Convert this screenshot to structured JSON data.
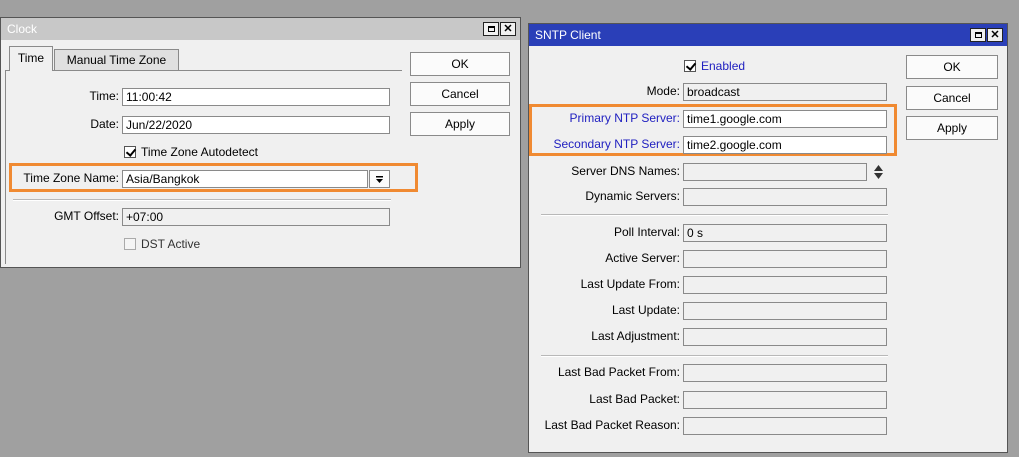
{
  "clock": {
    "title": "Clock",
    "tabs": [
      "Time",
      "Manual Time Zone"
    ],
    "time_label": "Time:",
    "time_value": "11:00:42",
    "date_label": "Date:",
    "date_value": "Jun/22/2020",
    "autodetect_label": "Time Zone Autodetect",
    "autodetect_checked": true,
    "tz_label": "Time Zone Name:",
    "tz_value": "Asia/Bangkok",
    "gmt_label": "GMT Offset:",
    "gmt_value": "+07:00",
    "dst_label": "DST Active",
    "dst_checked": false,
    "buttons": {
      "ok": "OK",
      "cancel": "Cancel",
      "apply": "Apply"
    }
  },
  "sntp": {
    "title": "SNTP Client",
    "enabled_label": "Enabled",
    "enabled_checked": true,
    "mode_label": "Mode:",
    "mode_value": "broadcast",
    "primary_label": "Primary NTP Server:",
    "primary_value": "time1.google.com",
    "secondary_label": "Secondary NTP Server:",
    "secondary_value": "time2.google.com",
    "dns_label": "Server DNS Names:",
    "dns_value": "",
    "dynamic_label": "Dynamic Servers:",
    "dynamic_value": "",
    "poll_label": "Poll Interval:",
    "poll_value": "0 s",
    "active_label": "Active Server:",
    "active_value": "",
    "last_update_from_label": "Last Update From:",
    "last_update_from_value": "",
    "last_update_label": "Last Update:",
    "last_update_value": "",
    "last_adjustment_label": "Last Adjustment:",
    "last_adjustment_value": "",
    "bad_from_label": "Last Bad Packet From:",
    "bad_from_value": "",
    "bad_label": "Last Bad Packet:",
    "bad_value": "",
    "bad_reason_label": "Last Bad Packet Reason:",
    "bad_reason_value": "",
    "buttons": {
      "ok": "OK",
      "cancel": "Cancel",
      "apply": "Apply"
    }
  },
  "colors": {
    "clock_titlebar": "#c8c8c8",
    "sntp_titlebar": "#2a3fb8",
    "highlight": "#f08a32",
    "desktop": "#a0a0a0"
  }
}
